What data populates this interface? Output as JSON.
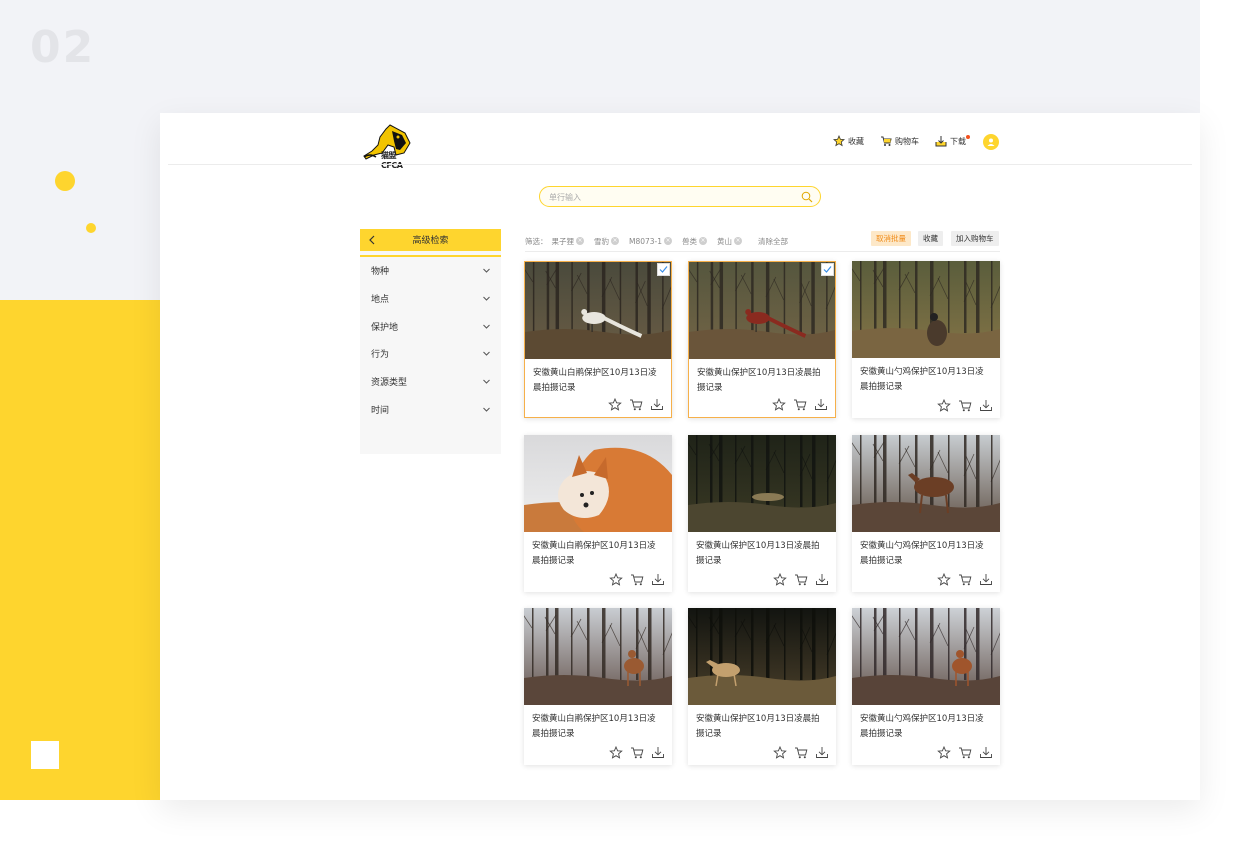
{
  "slide_number": "02",
  "logo": {
    "text": "猫盟CFCA"
  },
  "nav": {
    "favorites": "收藏",
    "cart": "购物车",
    "download": "下载"
  },
  "search": {
    "placeholder": "单行输入"
  },
  "sidebar": {
    "title": "高级检索",
    "items": [
      {
        "label": "物种"
      },
      {
        "label": "地点"
      },
      {
        "label": "保护地"
      },
      {
        "label": "行为"
      },
      {
        "label": "资源类型"
      },
      {
        "label": "时间"
      }
    ]
  },
  "filters": {
    "label": "筛选：",
    "chips": [
      "果子狸",
      "雪豹",
      "M8073-1",
      "兽类",
      "黄山"
    ],
    "clear_all": "清除全部"
  },
  "actions": {
    "cancel_batch": "取消批量",
    "favorite": "收藏",
    "add_to_cart": "加入购物车"
  },
  "cards": [
    {
      "caption": "安徽黄山白鹇保护区10月13日凌晨拍摄记录",
      "selected": true,
      "scene": "pheasant-white"
    },
    {
      "caption": "安徽黄山保护区10月13日凌晨拍摄记录",
      "selected": true,
      "scene": "pheasant-red"
    },
    {
      "caption": "安徽黄山勺鸡保护区10月13日凌晨拍摄记录",
      "selected": false,
      "scene": "bird-forest"
    },
    {
      "caption": "安徽黄山白鹇保护区10月13日凌晨拍摄记录",
      "selected": false,
      "scene": "fox"
    },
    {
      "caption": "安徽黄山保护区10月13日凌晨拍摄记录",
      "selected": false,
      "scene": "night-forest"
    },
    {
      "caption": "安徽黄山勺鸡保护区10月13日凌晨拍摄记录",
      "selected": false,
      "scene": "deer-frost"
    },
    {
      "caption": "安徽黄山白鹇保护区10月13日凌晨拍摄记录",
      "selected": false,
      "scene": "muntjac-frost"
    },
    {
      "caption": "安徽黄山保护区10月13日凌晨拍摄记录",
      "selected": false,
      "scene": "deer-night"
    },
    {
      "caption": "安徽黄山勺鸡保护区10月13日凌晨拍摄记录",
      "selected": false,
      "scene": "muntjac-frost-2"
    }
  ],
  "colors": {
    "accent": "#fed52e",
    "selected_border": "#f6b04a",
    "check": "#3a8ee6"
  }
}
